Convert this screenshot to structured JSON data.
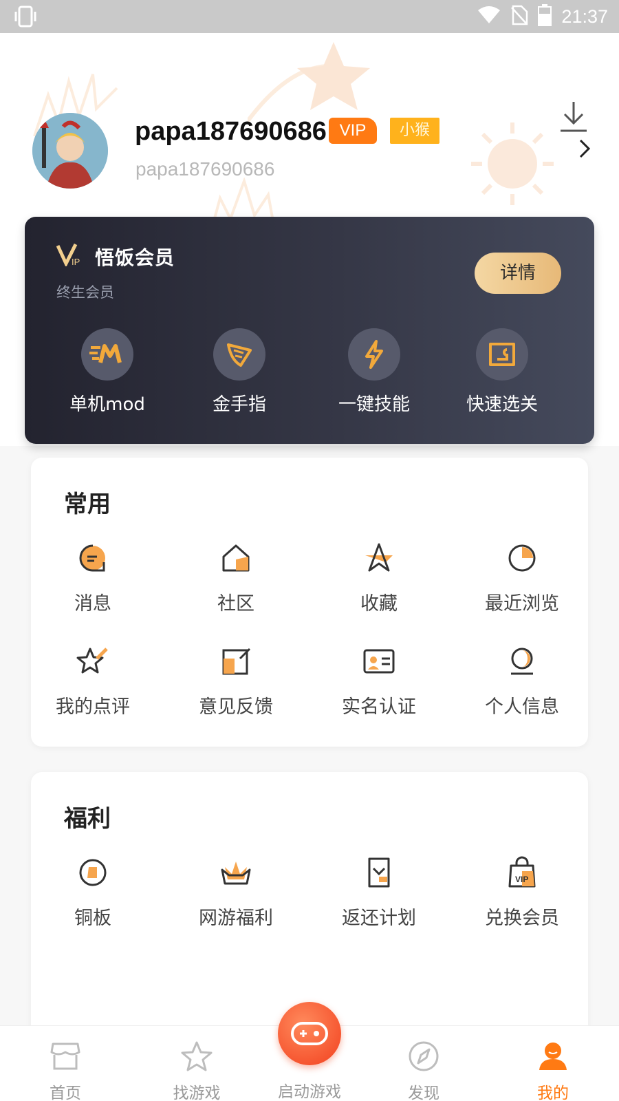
{
  "status_bar": {
    "time": "21:37"
  },
  "profile": {
    "username": "papa187690686",
    "vip_badge": "VIP",
    "level_badge": "小猴",
    "user_id": "papa187690686"
  },
  "vip_card": {
    "title": "悟饭会员",
    "subtitle": "终生会员",
    "detail_button": "详情",
    "features": [
      {
        "label": "单机mod",
        "icon": "mod-m-icon"
      },
      {
        "label": "金手指",
        "icon": "wing-icon"
      },
      {
        "label": "一键技能",
        "icon": "lightning-icon"
      },
      {
        "label": "快速选关",
        "icon": "ticket-icon"
      }
    ]
  },
  "common": {
    "title": "常用",
    "items": [
      {
        "label": "消息",
        "icon": "message-icon"
      },
      {
        "label": "社区",
        "icon": "community-home-icon"
      },
      {
        "label": "收藏",
        "icon": "star-collect-icon"
      },
      {
        "label": "最近浏览",
        "icon": "recent-clock-icon"
      },
      {
        "label": "我的点评",
        "icon": "review-star-icon"
      },
      {
        "label": "意见反馈",
        "icon": "feedback-icon"
      },
      {
        "label": "实名认证",
        "icon": "id-card-icon"
      },
      {
        "label": "个人信息",
        "icon": "profile-info-icon"
      }
    ]
  },
  "welfare": {
    "title": "福利",
    "items": [
      {
        "label": "铜板",
        "icon": "coin-icon"
      },
      {
        "label": "网游福利",
        "icon": "crown-gift-icon"
      },
      {
        "label": "返还计划",
        "icon": "refund-icon"
      },
      {
        "label": "兑换会员",
        "icon": "vip-bag-icon"
      }
    ]
  },
  "bottom_nav": {
    "items": [
      {
        "label": "首页",
        "icon": "home-store-icon"
      },
      {
        "label": "找游戏",
        "icon": "star-icon"
      },
      {
        "label": "启动游戏",
        "icon": "gamepad-icon"
      },
      {
        "label": "发现",
        "icon": "compass-icon"
      },
      {
        "label": "我的",
        "icon": "user-icon"
      }
    ],
    "active": "我的"
  },
  "colors": {
    "accent": "#ff7a13",
    "vip_gold": "#e7b978",
    "card_dark": "#2b2c39"
  }
}
